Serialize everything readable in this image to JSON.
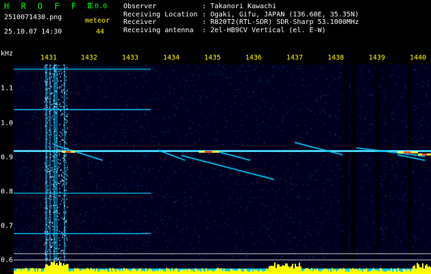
{
  "app": {
    "title": "H R O F F T",
    "version": "1.0.0",
    "filename": "2510071430.png",
    "datetime": "25.10.07 14:30",
    "meteor_label": "meteor",
    "meteor_count": "44"
  },
  "info": [
    {
      "key": "Observer",
      "value": "Takanori Kawachi"
    },
    {
      "key": "Receiving Location",
      "value": "Ogaki, Gifu, JAPAN (136.60E, 35.35N)"
    },
    {
      "key": "Receiver",
      "value": "R820T2(RTL-SDR) SDR-Sharp 53.1000MHz"
    },
    {
      "key": "Receiving antenna",
      "value": "2el-HB9CV Vertical (el. E-W)"
    }
  ],
  "axis": {
    "freq_unit": "kHz",
    "time_ticks": [
      "1431",
      "1432",
      "1433",
      "1434",
      "1435",
      "1436",
      "1437",
      "1438",
      "1439",
      "1440"
    ],
    "freq_ticks": [
      "1.1",
      "1.0",
      "0.9",
      "0.8",
      "0.7",
      "0.6"
    ]
  },
  "colors": {
    "title": "#00ff00",
    "info_text": "#ffffff",
    "label_yellow": "#ffff00",
    "waterfall_bg": "#00001e",
    "signal": "#00c8ff",
    "meteor": "#ffff40",
    "hot": "#ff3030",
    "baseline": "#c0c0c0",
    "spectrum_fill": "#ffff00"
  }
}
